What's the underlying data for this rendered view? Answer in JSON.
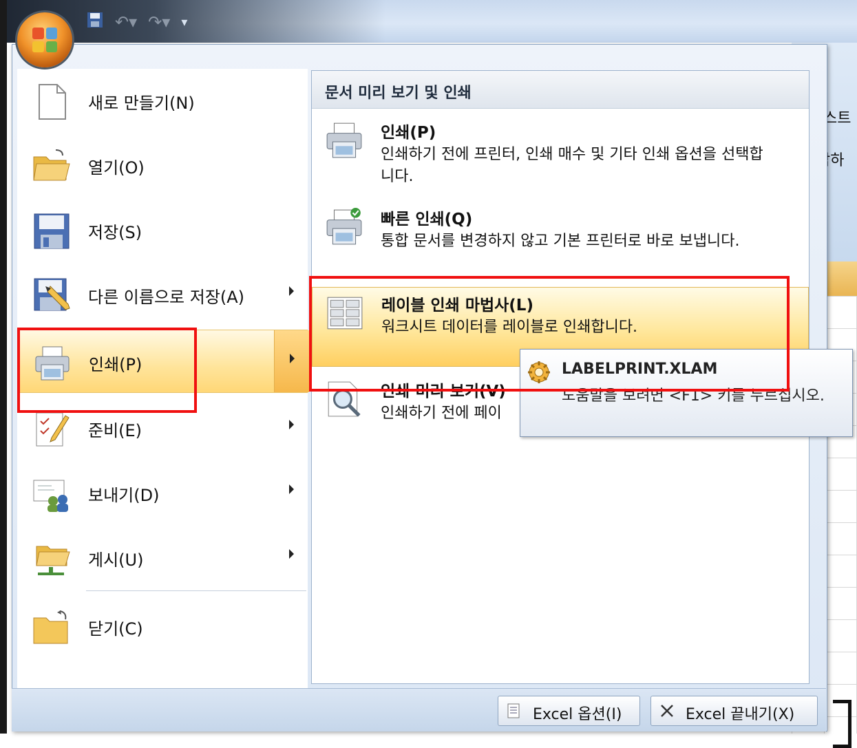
{
  "app": {
    "ribbon_partial_1": "스트",
    "ribbon_partial_2": "합하"
  },
  "left_menu": {
    "items": [
      {
        "label": "새로 만들기(N)",
        "icon": "new-document-icon",
        "has_submenu": false
      },
      {
        "label": "열기(O)",
        "icon": "open-folder-icon",
        "has_submenu": false
      },
      {
        "label": "저장(S)",
        "icon": "save-disk-icon",
        "has_submenu": false
      },
      {
        "label": "다른 이름으로 저장(A)",
        "icon": "save-as-icon",
        "has_submenu": true
      },
      {
        "label": "인쇄(P)",
        "icon": "printer-icon",
        "has_submenu": true,
        "active": true
      },
      {
        "label": "준비(E)",
        "icon": "prepare-icon",
        "has_submenu": true
      },
      {
        "label": "보내기(D)",
        "icon": "send-icon",
        "has_submenu": true
      },
      {
        "label": "게시(U)",
        "icon": "publish-icon",
        "has_submenu": true
      },
      {
        "label": "닫기(C)",
        "icon": "close-folder-icon",
        "has_submenu": false
      }
    ]
  },
  "right_menu": {
    "header": "문서 미리 보기 및 인쇄",
    "items": [
      {
        "title": "인쇄(P)",
        "description": "인쇄하기 전에 프린터, 인쇄 매수 및 기타 인쇄 옵션을 선택합니다.",
        "icon": "printer-icon"
      },
      {
        "title": "빠른 인쇄(Q)",
        "description": "통합 문서를 변경하지 않고 기본 프린터로 바로 보냅니다.",
        "icon": "quick-print-icon"
      },
      {
        "title": "레이블 인쇄 마법사(L)",
        "description": "워크시트 데이터를 레이블로 인쇄합니다.",
        "icon": "label-grid-icon",
        "highlighted": true
      },
      {
        "title": "인쇄 미리 보기(V)",
        "description": "인쇄하기 전에 페이",
        "icon": "magnifier-icon"
      }
    ]
  },
  "tooltip": {
    "title": "LABELPRINT.XLAM",
    "text": "도움말을 보려면 <F1> 키를 누르십시오.",
    "icon": "addin-gear-icon"
  },
  "footer": {
    "options_label": "Excel 옵션(I)",
    "exit_label": "Excel 끝내기(X)"
  },
  "colors": {
    "highlight": "#ffd777",
    "annotation_red": "#f01010",
    "menu_bg": "#dce7f5"
  }
}
